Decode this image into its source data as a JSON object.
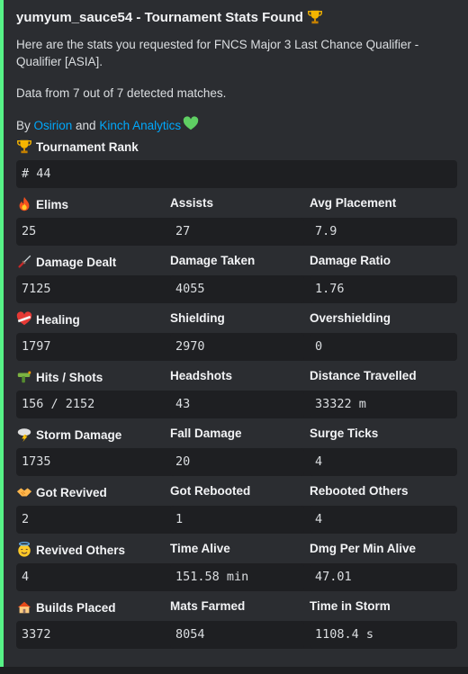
{
  "embed": {
    "accent_color": "#57f287",
    "title": "yumyum_sauce54 - Tournament Stats Found",
    "title_icon": "trophy-icon",
    "description_line1": "Here are the stats you requested for FNCS Major 3 Last Chance Qualifier - Qualifier [ASIA].",
    "description_line2": "Data from 7 out of 7 detected matches.",
    "by_prefix": "By ",
    "link1": "Osirion",
    "and_text": " and ",
    "link2": "Kinch Analytics",
    "heart_icon": "green-heart-icon"
  },
  "rank": {
    "icon": "trophy-icon",
    "label": "Tournament Rank",
    "value": "# 44"
  },
  "rows": [
    [
      {
        "icon": "fire-icon",
        "label": "Elims",
        "value": "25"
      },
      {
        "label": "Assists",
        "value": "27"
      },
      {
        "label": "Avg Placement",
        "value": "7.9"
      }
    ],
    [
      {
        "icon": "dagger-icon",
        "label": "Damage Dealt",
        "value": "7125"
      },
      {
        "label": "Damage Taken",
        "value": "4055"
      },
      {
        "label": "Damage Ratio",
        "value": "1.76"
      }
    ],
    [
      {
        "icon": "mending-heart-icon",
        "label": "Healing",
        "value": "1797"
      },
      {
        "label": "Shielding",
        "value": "2970"
      },
      {
        "label": "Overshielding",
        "value": "0"
      }
    ],
    [
      {
        "icon": "water-pistol-icon",
        "label": "Hits / Shots",
        "value": "156 / 2152"
      },
      {
        "label": "Headshots",
        "value": "43"
      },
      {
        "label": "Distance Travelled",
        "value": "33322 m"
      }
    ],
    [
      {
        "icon": "storm-cloud-icon",
        "label": "Storm Damage",
        "value": "1735"
      },
      {
        "label": "Fall Damage",
        "value": "20"
      },
      {
        "label": "Surge Ticks",
        "value": "4"
      }
    ],
    [
      {
        "icon": "handshake-icon",
        "label": "Got Revived",
        "value": "2"
      },
      {
        "label": "Got Rebooted",
        "value": "1"
      },
      {
        "label": "Rebooted Others",
        "value": "4"
      }
    ],
    [
      {
        "icon": "halo-face-icon",
        "label": "Revived Others",
        "value": "4"
      },
      {
        "label": "Time Alive",
        "value": "151.58 min"
      },
      {
        "label": "Dmg Per Min Alive",
        "value": "47.01"
      }
    ],
    [
      {
        "icon": "house-icon",
        "label": "Builds Placed",
        "value": "3372"
      },
      {
        "label": "Mats Farmed",
        "value": "8054"
      },
      {
        "label": "Time in Storm",
        "value": "1108.4 s"
      }
    ]
  ]
}
